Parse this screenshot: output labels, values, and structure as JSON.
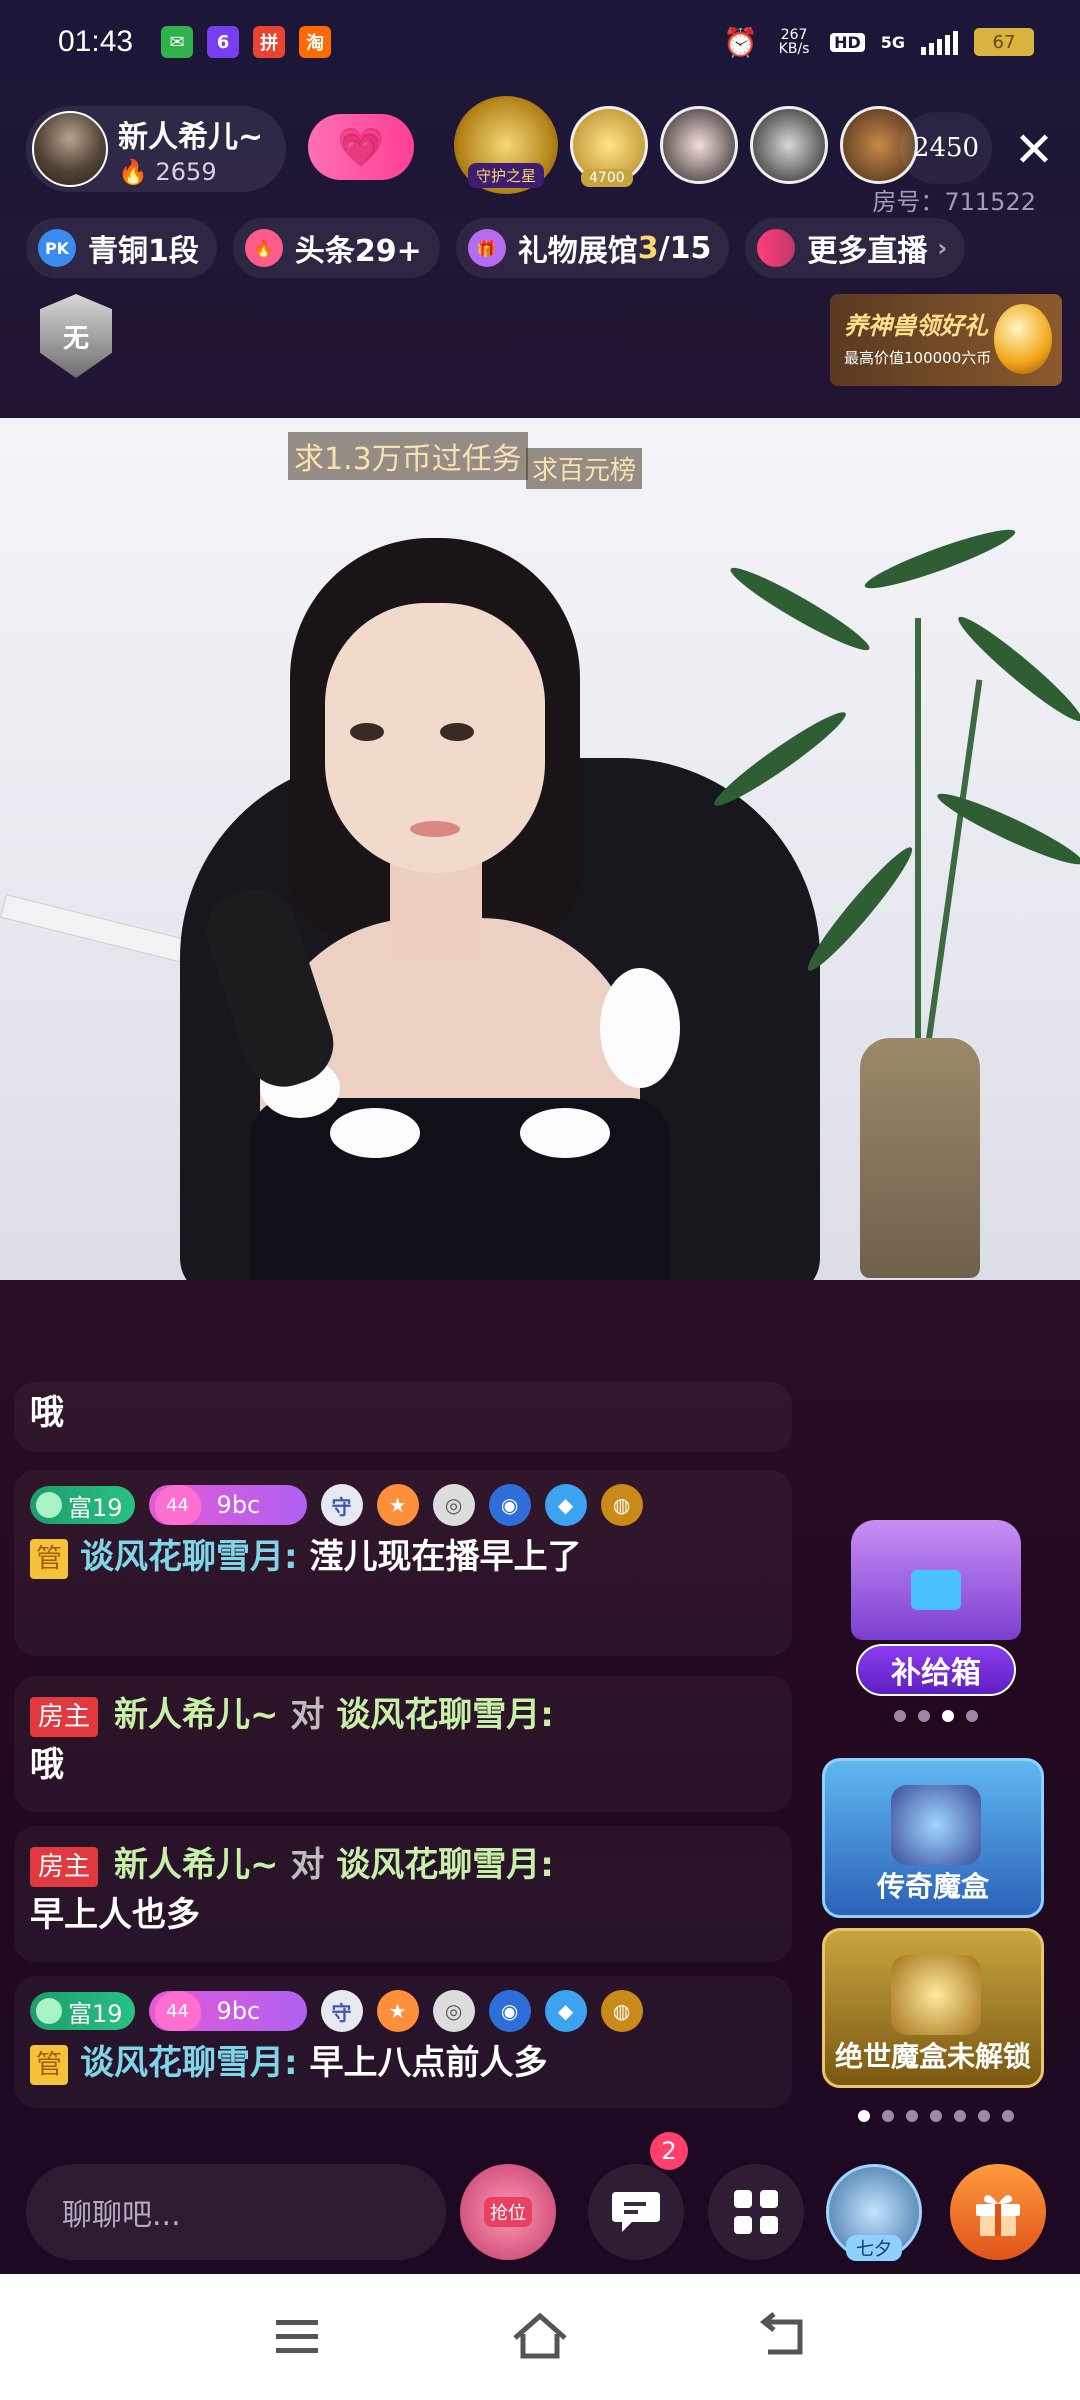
{
  "status_bar": {
    "time": "01:43",
    "net_speed": "267 KB/s",
    "hd": "HD",
    "signal": "5G",
    "battery": "67"
  },
  "header": {
    "host_name": "新人希儿~",
    "host_fans": "2659",
    "follow_icon": "heart-plus-icon",
    "viewer_badge": "守护之星",
    "viewer_tag": "4700",
    "viewer_count": "2450",
    "room_id_label": "房号：711522"
  },
  "tags": [
    {
      "icon": "PK",
      "label": "青铜1段"
    },
    {
      "icon": "flame",
      "label": "头条29+"
    },
    {
      "icon": "gift-hall",
      "label_prefix": "礼物展馆",
      "label_highlight": "3",
      "label_suffix": "/15"
    },
    {
      "icon": "dots",
      "label": "更多直播"
    }
  ],
  "rank_badge": "无",
  "promo": {
    "title": "养神兽领好礼",
    "subtitle": "最高价值100000六币"
  },
  "video": {
    "banner1": "求1.3万币过任务",
    "banner2": "求百元榜"
  },
  "chat": [
    {
      "text": "哦"
    },
    {
      "badge_fu": "富19",
      "badge_heart_num": "44",
      "badge_heart_text": "9bc",
      "guard": "守",
      "tag": "管",
      "sender": "谈风花聊雪月",
      "content": "滢儿现在播早上了"
    },
    {
      "tag": "房主",
      "sender": "新人希儿~",
      "to_word": "对",
      "target": "谈风花聊雪月:",
      "content": "哦"
    },
    {
      "tag": "房主",
      "sender": "新人希儿~",
      "to_word": "对",
      "target": "谈风花聊雪月:",
      "content": "早上人也多"
    },
    {
      "badge_fu": "富19",
      "badge_heart_num": "44",
      "badge_heart_text": "9bc",
      "guard": "守",
      "tag": "管",
      "sender": "谈风花聊雪月",
      "content": "早上八点前人多"
    }
  ],
  "side": {
    "supply_label": "补给箱",
    "magic1_label": "传奇魔盒",
    "magic2_label": "绝世魔盒未解锁"
  },
  "bottom": {
    "input_placeholder": "聊聊吧...",
    "seat_label": "抢位",
    "notif_count": "2",
    "avatar_label": "七夕"
  },
  "colors": {
    "accent_pink": "#ff3f95",
    "chat_sender": "#7fd6e8",
    "host_green": "#c7f0a8",
    "room_tag": "#e0393f"
  }
}
